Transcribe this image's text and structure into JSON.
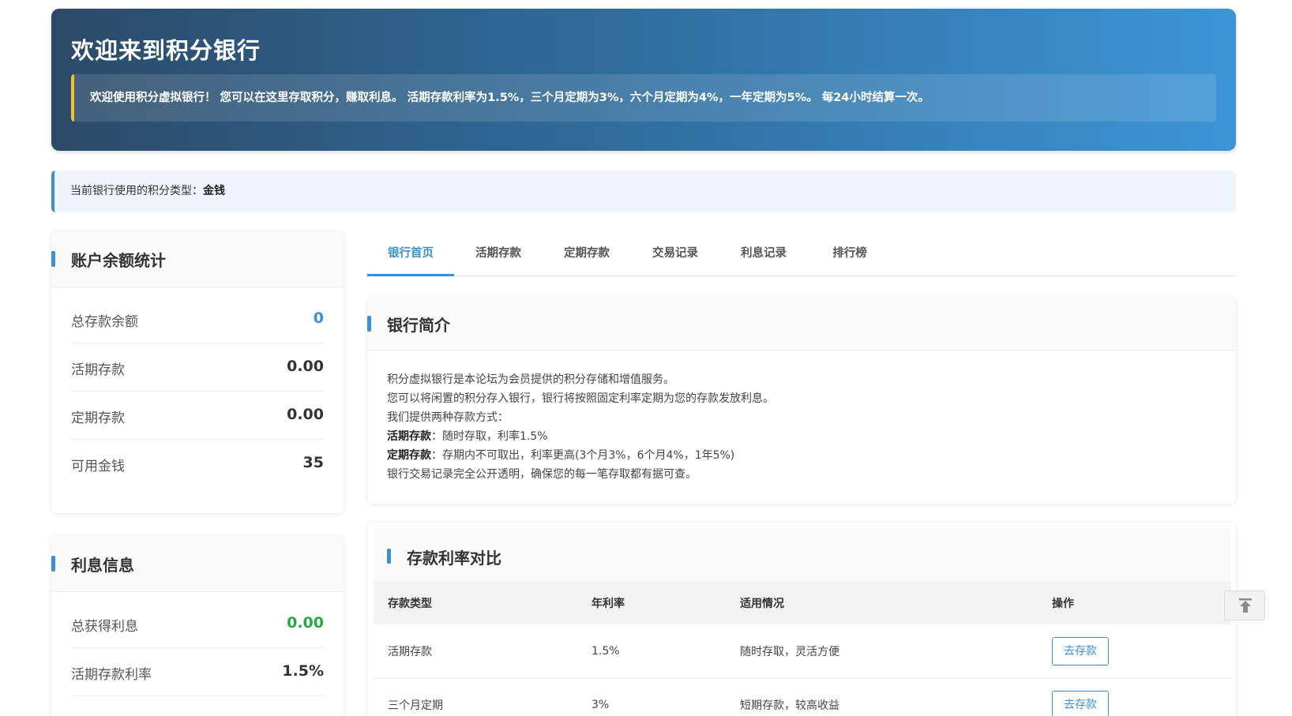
{
  "hero": {
    "title": "欢迎来到积分银行",
    "notice": "欢迎使用积分虚拟银行！ 您可以在这里存取积分，赚取利息。 活期存款利率为1.5%，三个月定期为3%，六个月定期为4%，一年定期为5%。 每24小时结算一次。"
  },
  "currency": {
    "label": "当前银行使用的积分类型：",
    "value": "金钱"
  },
  "balance": {
    "title": "账户余额统计",
    "rows": [
      {
        "label": "总存款余额",
        "value": "0"
      },
      {
        "label": "活期存款",
        "value": "0.00"
      },
      {
        "label": "定期存款",
        "value": "0.00"
      },
      {
        "label": "可用金钱",
        "value": "35"
      }
    ]
  },
  "interest": {
    "title": "利息信息",
    "rows": [
      {
        "label": "总获得利息",
        "value": "0.00"
      },
      {
        "label": "活期存款利率",
        "value": "1.5%"
      }
    ]
  },
  "tabs": [
    {
      "label": "银行首页",
      "active": true
    },
    {
      "label": "活期存款"
    },
    {
      "label": "定期存款"
    },
    {
      "label": "交易记录"
    },
    {
      "label": "利息记录"
    },
    {
      "label": "排行榜"
    }
  ],
  "intro": {
    "title": "银行简介",
    "line1": "积分虚拟银行是本论坛为会员提供的积分存储和增值服务。",
    "line2": "您可以将闲置的积分存入银行，银行将按照固定利率定期为您的存款发放利息。",
    "line3": "我们提供两种存款方式：",
    "line4_label": "活期存款",
    "line4_text": "：随时存取，利率1.5%",
    "line5_label": "定期存款",
    "line5_text": "：存期内不可取出，利率更高(3个月3%，6个月4%，1年5%)",
    "line6": "银行交易记录完全公开透明，确保您的每一笔存取都有据可查。"
  },
  "rates": {
    "title": "存款利率对比",
    "headers": [
      "存款类型",
      "年利率",
      "适用情况",
      "操作"
    ],
    "rows": [
      {
        "type": "活期存款",
        "rate": "1.5%",
        "usage": "随时存取，灵活方便",
        "action": "去存款"
      },
      {
        "type": "三个月定期",
        "rate": "3%",
        "usage": "短期存款，较高收益",
        "action": "去存款"
      }
    ]
  },
  "colors": {
    "accent": "#3b8fd6",
    "green": "#27a844",
    "notice_border": "#f2c230"
  },
  "icons": {
    "back_to_top": "arrow-up-to-line-icon"
  }
}
